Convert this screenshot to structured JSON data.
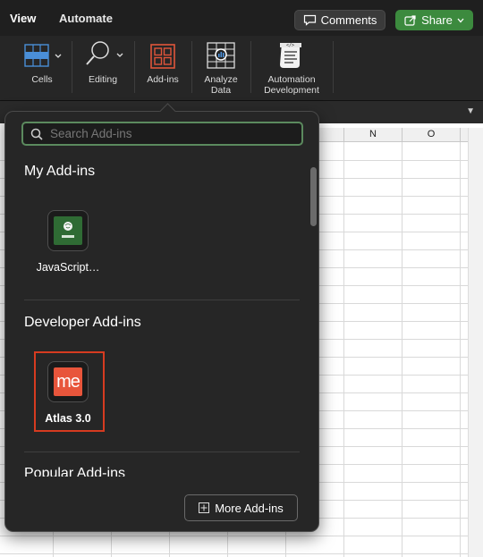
{
  "tabs": {
    "view": "View",
    "automate": "Automate"
  },
  "header_buttons": {
    "comments": "Comments",
    "share": "Share"
  },
  "ribbon": {
    "cells": "Cells",
    "editing": "Editing",
    "addins": "Add-ins",
    "analyze_data_line1": "Analyze",
    "analyze_data_line2": "Data",
    "automation_line1": "Automation",
    "automation_line2": "Development"
  },
  "sheet": {
    "col_n": "N",
    "col_o": "O"
  },
  "popover": {
    "search_placeholder": "Search Add-ins",
    "my_addins_title": "My Add-ins",
    "my_addins": [
      {
        "label": "JavaScript…",
        "icon": "javascript-addin-icon"
      }
    ],
    "developer_title": "Developer Add-ins",
    "developer_addins": [
      {
        "label": "Atlas 3.0",
        "icon": "atlas-me-icon",
        "icon_text": "me",
        "accent": "#e8553b"
      }
    ],
    "popular_title": "Popular Add-ins",
    "more_button": "More Add-ins"
  },
  "colors": {
    "share_green": "#3c8a3e",
    "search_border": "#5b8a5e",
    "highlight_red": "#d63b20"
  }
}
